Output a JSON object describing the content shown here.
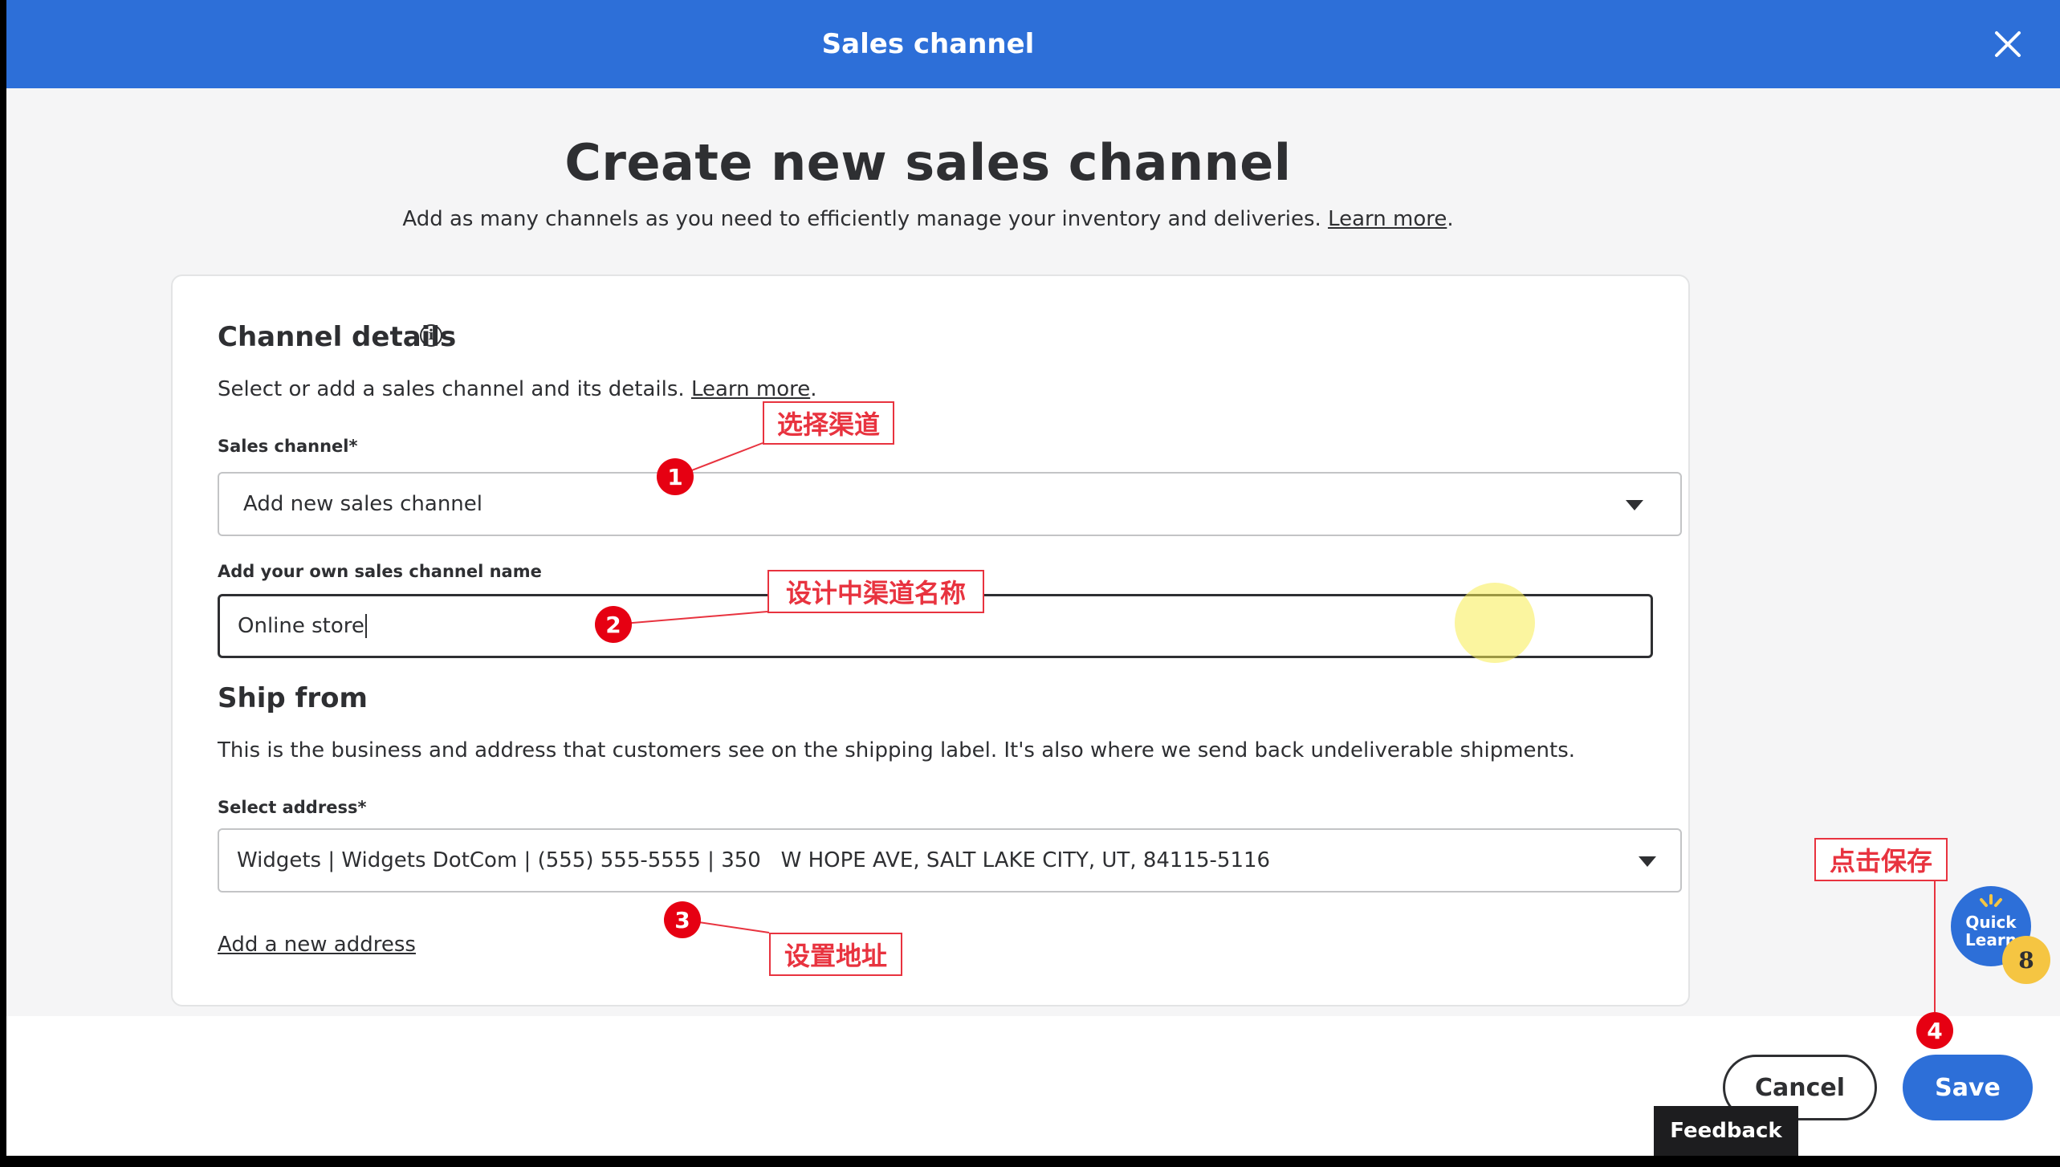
{
  "window": {
    "title": "Sales channel"
  },
  "page": {
    "heading": "Create new sales channel",
    "subtitle": "Add as many channels as you need to efficiently manage your inventory and deliveries.",
    "subtitle_link": "Learn more",
    "subtitle_end": "."
  },
  "channel_details": {
    "heading": "Channel details",
    "info_glyph": "i",
    "description": "Select or add a sales channel and its details.",
    "description_link": "Learn more",
    "description_end": ".",
    "sales_channel_label": "Sales channel*",
    "sales_channel_value": "Add new sales channel",
    "own_name_label": "Add your own sales channel name",
    "own_name_value": "Online store"
  },
  "ship_from": {
    "heading": "Ship from",
    "description": "This is the business and address that customers see on the shipping label. It's also where we send back undeliverable shipments.",
    "address_label": "Select address*",
    "address_value": "Widgets | Widgets DotCom | (555) 555-5555 | 350   W HOPE AVE, SALT LAKE CITY, UT, 84115-5116",
    "add_address_link": "Add a new address"
  },
  "footer": {
    "cancel_label": "Cancel",
    "save_label": "Save",
    "feedback_label": "Feedback"
  },
  "quick_learn": {
    "line1": "Quick",
    "line2": "Learn",
    "badge": "8"
  },
  "annotations": [
    {
      "number": "1",
      "label": "选择渠道"
    },
    {
      "number": "2",
      "label": "设计中渠道名称"
    },
    {
      "number": "3",
      "label": "设置地址"
    },
    {
      "number": "4",
      "label": "点击保存"
    }
  ],
  "colors": {
    "brand_blue": "#2d6fd8",
    "annotation_red": "#e60012",
    "text_dark": "#2e2f32",
    "quick_learn_badge": "#f5c542"
  }
}
